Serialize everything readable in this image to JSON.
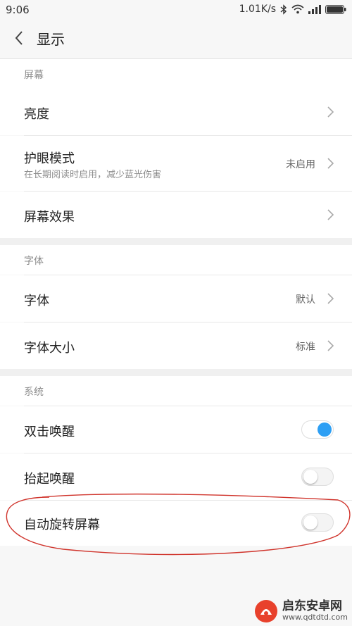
{
  "status_bar": {
    "time": "9:06",
    "net_speed": "1.01K/s"
  },
  "header": {
    "title": "显示"
  },
  "sections": {
    "screen": {
      "header": "屏幕"
    },
    "font": {
      "header": "字体"
    },
    "system": {
      "header": "系统"
    }
  },
  "rows": {
    "brightness": {
      "label": "亮度"
    },
    "eye_care": {
      "label": "护眼模式",
      "subtitle": "在长期阅读时启用，减少蓝光伤害",
      "value": "未启用"
    },
    "screen_effect": {
      "label": "屏幕效果"
    },
    "font": {
      "label": "字体",
      "value": "默认"
    },
    "font_size": {
      "label": "字体大小",
      "value": "标准"
    },
    "double_tap_wake": {
      "label": "双击唤醒",
      "enabled": true
    },
    "lift_wake": {
      "label": "抬起唤醒",
      "enabled": false
    },
    "auto_rotate": {
      "label": "自动旋转屏幕",
      "enabled": false
    }
  },
  "annotation": {
    "color": "#d0342c"
  },
  "accent_color": "#2d9ff4",
  "watermark": {
    "name": "启东安卓网",
    "url": "www.qdtdtd.com"
  }
}
